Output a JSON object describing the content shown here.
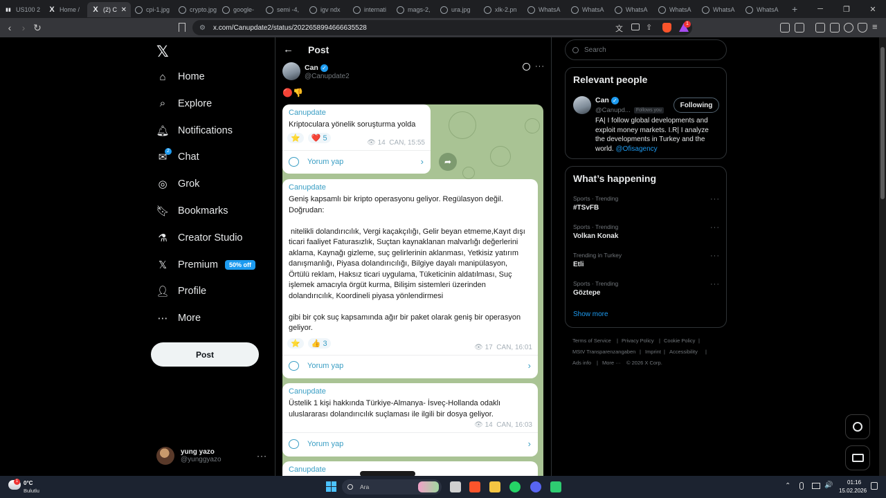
{
  "browser": {
    "tabs": [
      {
        "label": "US100 2",
        "icon": "tradingview-icon"
      },
      {
        "label": "Home /",
        "icon": "x-icon"
      },
      {
        "label": "(2) C",
        "icon": "x-icon",
        "active": true
      },
      {
        "label": "cpi-1.jpg",
        "icon": "globe-icon"
      },
      {
        "label": "crypto.jpg",
        "icon": "globe-icon"
      },
      {
        "label": "google-",
        "icon": "globe-icon"
      },
      {
        "label": "semi -4,",
        "icon": "globe-icon"
      },
      {
        "label": "igv ndx",
        "icon": "globe-icon"
      },
      {
        "label": "internati",
        "icon": "globe-icon"
      },
      {
        "label": "mags-2,",
        "icon": "globe-icon"
      },
      {
        "label": "ura.jpg",
        "icon": "globe-icon"
      },
      {
        "label": "xlk-2.pn",
        "icon": "globe-icon"
      },
      {
        "label": "WhatsA",
        "icon": "globe-icon"
      },
      {
        "label": "WhatsA",
        "icon": "globe-icon"
      },
      {
        "label": "WhatsA",
        "icon": "globe-icon"
      },
      {
        "label": "WhatsA",
        "icon": "globe-icon"
      },
      {
        "label": "WhatsA",
        "icon": "globe-icon"
      },
      {
        "label": "WhatsA",
        "icon": "globe-icon"
      }
    ],
    "url": "x.com/Canupdate2/status/2022658994666635528",
    "shield_count": "1"
  },
  "x_nav": {
    "items": [
      {
        "label": "Home",
        "icon": "home-icon"
      },
      {
        "label": "Explore",
        "icon": "search-icon"
      },
      {
        "label": "Notifications",
        "icon": "bell-icon"
      },
      {
        "label": "Chat",
        "icon": "mail-icon",
        "badge": "2"
      },
      {
        "label": "Grok",
        "icon": "grok-icon"
      },
      {
        "label": "Bookmarks",
        "icon": "bookmark-icon"
      },
      {
        "label": "Creator Studio",
        "icon": "flask-icon"
      },
      {
        "label": "Premium",
        "icon": "x-icon",
        "badge": "50% off"
      },
      {
        "label": "Profile",
        "icon": "person-icon"
      },
      {
        "label": "More",
        "icon": "more-circle-icon"
      }
    ],
    "post_label": "Post",
    "user": {
      "name": "yung yazo",
      "handle": "@yunggyazo"
    }
  },
  "post": {
    "header_title": "Post",
    "author_name": "Can",
    "author_handle": "@Canupdate2",
    "emoji": "🔴👎",
    "messages": [
      {
        "sender": "Canupdate",
        "text": "Kriptoculara yönelik soruşturma yolda",
        "reactions": [
          {
            "emoji": "⭐",
            "count": ""
          },
          {
            "emoji": "❤️",
            "count": "5"
          }
        ],
        "views": "14",
        "time": "CAN, 15:55",
        "comment": "Yorum yap"
      },
      {
        "sender": "Canupdate",
        "lines": [
          "Geniş kapsamlı bir kripto operasyonu geliyor. Regülasyon değil.",
          "Doğrudan:",
          "",
          " nitelikli dolandırıcılık, Vergi kaçakçılığı, Gelir beyan etmeme,Kayıt dışı",
          "ticari faaliyet Faturasızlık, Suçtan kaynaklanan malvarlığı değerlerini",
          "aklama, Kaynağı gizleme, suç gelirlerinin aklanması, Yetkisiz yatırım",
          "danışmanlığı, Piyasa dolandırıcılığı, Bilgiye dayalı manipülasyon,",
          "Örtülü reklam, Haksız ticari uygulama, Tüketicinin aldatılması, Suç",
          "işlemek amacıyla örgüt kurma, Bilişim sistemleri üzerinden",
          "dolandırıcılık, Koordineli piyasa yönlendirmesi",
          "",
          "gibi bir çok suç kapsamında ağır bir paket olarak geniş bir operasyon",
          "geliyor."
        ],
        "reactions": [
          {
            "emoji": "⭐",
            "count": ""
          },
          {
            "emoji": "👍",
            "count": "3"
          }
        ],
        "views": "17",
        "time": "CAN, 16:01",
        "comment": "Yorum yap"
      },
      {
        "sender": "Canupdate",
        "lines": [
          "Üstelik 1 kişi hakkında Türkiye-Almanya- İsveç-Hollanda odaklı",
          "uluslararası dolandırıcılık suçlaması ile ilgili bir dosya geliyor."
        ],
        "views": "14",
        "time": "CAN, 16:03",
        "comment": "Yorum yap"
      },
      {
        "sender": "Canupdate"
      }
    ]
  },
  "right": {
    "search_placeholder": "Search",
    "relevant_title": "Relevant people",
    "person": {
      "name": "Can",
      "handle": "@Canupd...",
      "follows_you": "Follows you",
      "follow_label": "Following",
      "bio_lines": [
        "FA| I follow global developments and",
        "exploit money markets. I.R| I analyze",
        "the developments in Turkey and the"
      ],
      "bio_last": "world.",
      "bio_link": "@Ofisagency"
    },
    "happening_title": "What’s happening",
    "trends": [
      {
        "category": "Sports · Trending",
        "name": "#TSvFB"
      },
      {
        "category": "Sports · Trending",
        "name": "Volkan Konak"
      },
      {
        "category": "Trending in Turkey",
        "name": "Etli"
      },
      {
        "category": "Sports · Trending",
        "name": "Göztepe"
      }
    ],
    "show_more": "Show more",
    "footer": [
      "Terms of Service",
      "Privacy Policy",
      "Cookie Policy",
      "MStV Transparenzangaben",
      "Imprint",
      "Accessibility",
      "Ads info",
      "More ···",
      "© 2026 X Corp."
    ]
  },
  "taskbar": {
    "weather_temp": "0°C",
    "weather_desc": "Bulutlu",
    "weather_badge": "1",
    "search_label": "Ara",
    "time": "01:16",
    "date": "15.02.2026"
  }
}
